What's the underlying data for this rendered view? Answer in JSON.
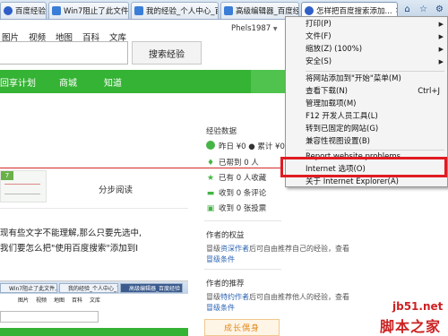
{
  "browser": {
    "tabs": [
      {
        "label": "百度经验",
        "active": false
      },
      {
        "label": "Win7阻止了此文件,因...",
        "active": false
      },
      {
        "label": "我的经验_个人中心_百...",
        "active": false
      },
      {
        "label": "高级编辑器_百度经验",
        "active": false
      },
      {
        "label": "怎样把百度搜索添加...",
        "active": true
      }
    ],
    "nav_icons": [
      "home-icon",
      "star-icon",
      "gear-icon"
    ]
  },
  "topnav": {
    "links": [
      "图片",
      "视频",
      "地图",
      "百科",
      "文库"
    ],
    "user": "Phels1987"
  },
  "search": {
    "button": "搜索经验"
  },
  "greenbar": {
    "items": [
      "回享计划",
      "商城",
      "知道"
    ]
  },
  "article": {
    "thumb_badge": "7",
    "steps_label": "分步阅读",
    "para1": "现有些文字不能理解,那么只要先选中,",
    "para2": "我们要怎么把\"使用百度搜索\"添加到I",
    "shot_tabs": [
      "Win7阻止了此文件,因...",
      "我的经验_个人中心_百度经验",
      "高级编辑器_百度经验"
    ],
    "shot_links": [
      "图片",
      "视频",
      "地图",
      "百科",
      "文库"
    ]
  },
  "sidebar": {
    "data_title": "经验数据",
    "stats": [
      {
        "icon": "coin-icon",
        "text": "昨日 ¥0 ● 累计 ¥0"
      },
      {
        "icon": "thumb-icon",
        "text": "已帮到 0 人"
      },
      {
        "icon": "star-icon",
        "text": "已有 0 人收藏"
      },
      {
        "icon": "comment-icon",
        "text": "收到 0 条评论"
      },
      {
        "icon": "vote-icon",
        "text": "收到 0 张投票"
      }
    ],
    "author_title": "作者的权益",
    "author_pre": "冒级",
    "author_link": "资深作者",
    "author_post": "后可自由推荐自己的经验，查看",
    "author_link2": "冒级条件",
    "recommend_title": "作者的推荐",
    "rec_pre": "冒级",
    "rec_link": "特约作者",
    "rec_post": "后可自由推荐他人的经验，查看",
    "rec_link2": "冒级条件",
    "promo": "成长偶身"
  },
  "tools_menu": {
    "items": [
      {
        "label": "打印(P)",
        "arrow": true
      },
      {
        "label": "文件(F)",
        "arrow": true
      },
      {
        "label": "缩放(Z) (100%)",
        "arrow": true
      },
      {
        "label": "安全(S)",
        "arrow": true
      },
      {
        "label": "将网站添加到\"开始\"菜单(M)",
        "arrow": false
      },
      {
        "label": "查看下载(N)",
        "shortcut": "Ctrl+J"
      },
      {
        "label": "管理加载项(M)",
        "arrow": false
      },
      {
        "label": "F12 开发人员工具(L)",
        "arrow": false
      },
      {
        "label": "转到已固定的网站(G)",
        "arrow": false
      },
      {
        "label": "兼容性视图设置(B)",
        "arrow": false
      },
      {
        "label": "Report website problems",
        "arrow": false
      },
      {
        "label": "Internet 选项(O)",
        "arrow": false
      },
      {
        "label": "关于 Internet Explorer(A)",
        "arrow": false
      }
    ],
    "highlighted_item": "Internet 选项(O)",
    "highlight_color": "#e01b22"
  },
  "watermark": {
    "url": "jb51.net",
    "name": "脚本之家"
  }
}
